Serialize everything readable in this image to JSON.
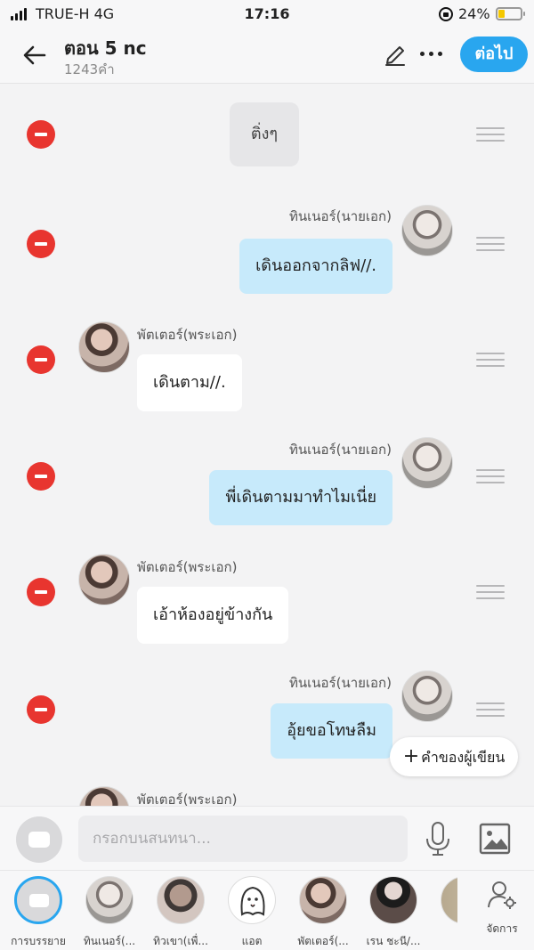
{
  "status_bar": {
    "carrier": "TRUE-H  4G",
    "time": "17:16",
    "battery": "24%"
  },
  "header": {
    "title": "ตอน 5 nc",
    "subtitle": "1243คำ",
    "next_label": "ต่อไป"
  },
  "chat": {
    "narration": "ติ่งๆ",
    "messages": [
      {
        "speaker": "ทินเนอร์(นายเอก)",
        "text": "เดินออกจากลิฟ//."
      },
      {
        "speaker": "พัตเตอร์(พระเอก)",
        "text": "เดินตาม//."
      },
      {
        "speaker": "ทินเนอร์(นายเอก)",
        "text": "พี่เดินตามมาทำไมเนี่ย"
      },
      {
        "speaker": "พัตเตอร์(พระเอก)",
        "text": "เอ้าห้องอยู่ข้างกัน"
      },
      {
        "speaker": "ทินเนอร์(นายเอก)",
        "text": "อุ้ยขอโทษลืม"
      },
      {
        "speaker": "พัตเตอร์(พระเอก)",
        "text": ""
      }
    ],
    "writer_note_label": "คำของผู้เขียน"
  },
  "input": {
    "placeholder": "กรอกบนสนทนา..."
  },
  "characters": [
    {
      "label": "การบรรยาย"
    },
    {
      "label": "ทินเนอร์(..."
    },
    {
      "label": "ทิวเขา(เพื่..."
    },
    {
      "label": "แอต"
    },
    {
      "label": "พัตเตอร์(..."
    },
    {
      "label": "เรน ชะนี/..."
    }
  ],
  "manage_label": "จัดการ",
  "colors": {
    "accent": "#29a6ef",
    "delete": "#e8352f",
    "bubble_right": "#c7eafb",
    "bubble_left": "#ffffff"
  }
}
